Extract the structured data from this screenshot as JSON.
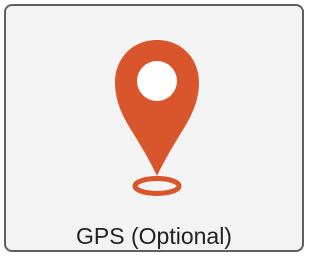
{
  "card": {
    "label": "GPS (Optional)",
    "icon": "map-pin-icon",
    "accent_color": "#d9552b",
    "background_color": "#f3f3f3",
    "border_color": "#5f5f5f"
  }
}
